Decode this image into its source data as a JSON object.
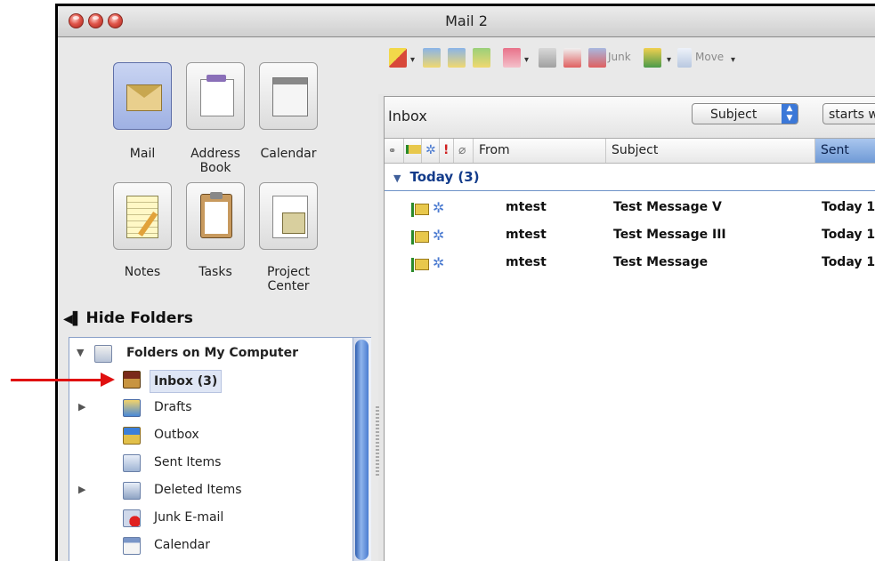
{
  "window": {
    "title": "Mail 2"
  },
  "apps": [
    {
      "name": "mail",
      "label": "Mail"
    },
    {
      "name": "address-book",
      "label": "Address\nBook"
    },
    {
      "name": "calendar",
      "label": "Calendar"
    },
    {
      "name": "notes",
      "label": "Notes"
    },
    {
      "name": "tasks",
      "label": "Tasks"
    },
    {
      "name": "project-center",
      "label": "Project\nCenter"
    }
  ],
  "hide_folders_label": "Hide Folders",
  "folders": {
    "root_label": "Folders on My Computer",
    "items": [
      {
        "label": "Inbox (3)",
        "icon": "inbox-icon",
        "expandable": false,
        "bold": true,
        "selected": true
      },
      {
        "label": "Drafts",
        "icon": "drafts-icon",
        "expandable": true
      },
      {
        "label": "Outbox",
        "icon": "outbox-icon",
        "expandable": false
      },
      {
        "label": "Sent Items",
        "icon": "sent-items-icon",
        "expandable": false
      },
      {
        "label": "Deleted Items",
        "icon": "deleted-items-icon",
        "expandable": true
      },
      {
        "label": "Junk E-mail",
        "icon": "junk-email-icon",
        "expandable": false
      },
      {
        "label": "Calendar",
        "icon": "calendar-folder-icon",
        "expandable": false
      }
    ]
  },
  "toolbar": {
    "junk_label": "Junk",
    "move_label": "Move"
  },
  "list": {
    "title": "Inbox",
    "search_field": "Subject",
    "search_op": "starts w",
    "columns": {
      "from": "From",
      "subject": "Subject",
      "sent": "Sent"
    },
    "group": "Today (3)",
    "messages": [
      {
        "from": "mtest",
        "subject": "Test Message V",
        "sent": "Today 1"
      },
      {
        "from": "mtest",
        "subject": "Test Message III",
        "sent": "Today 1"
      },
      {
        "from": "mtest",
        "subject": "Test Message",
        "sent": "Today 1"
      }
    ]
  },
  "colors": {
    "accent": "#3b78d8",
    "selection": "#9fb1e3",
    "annotation_arrow": "#e01010"
  }
}
